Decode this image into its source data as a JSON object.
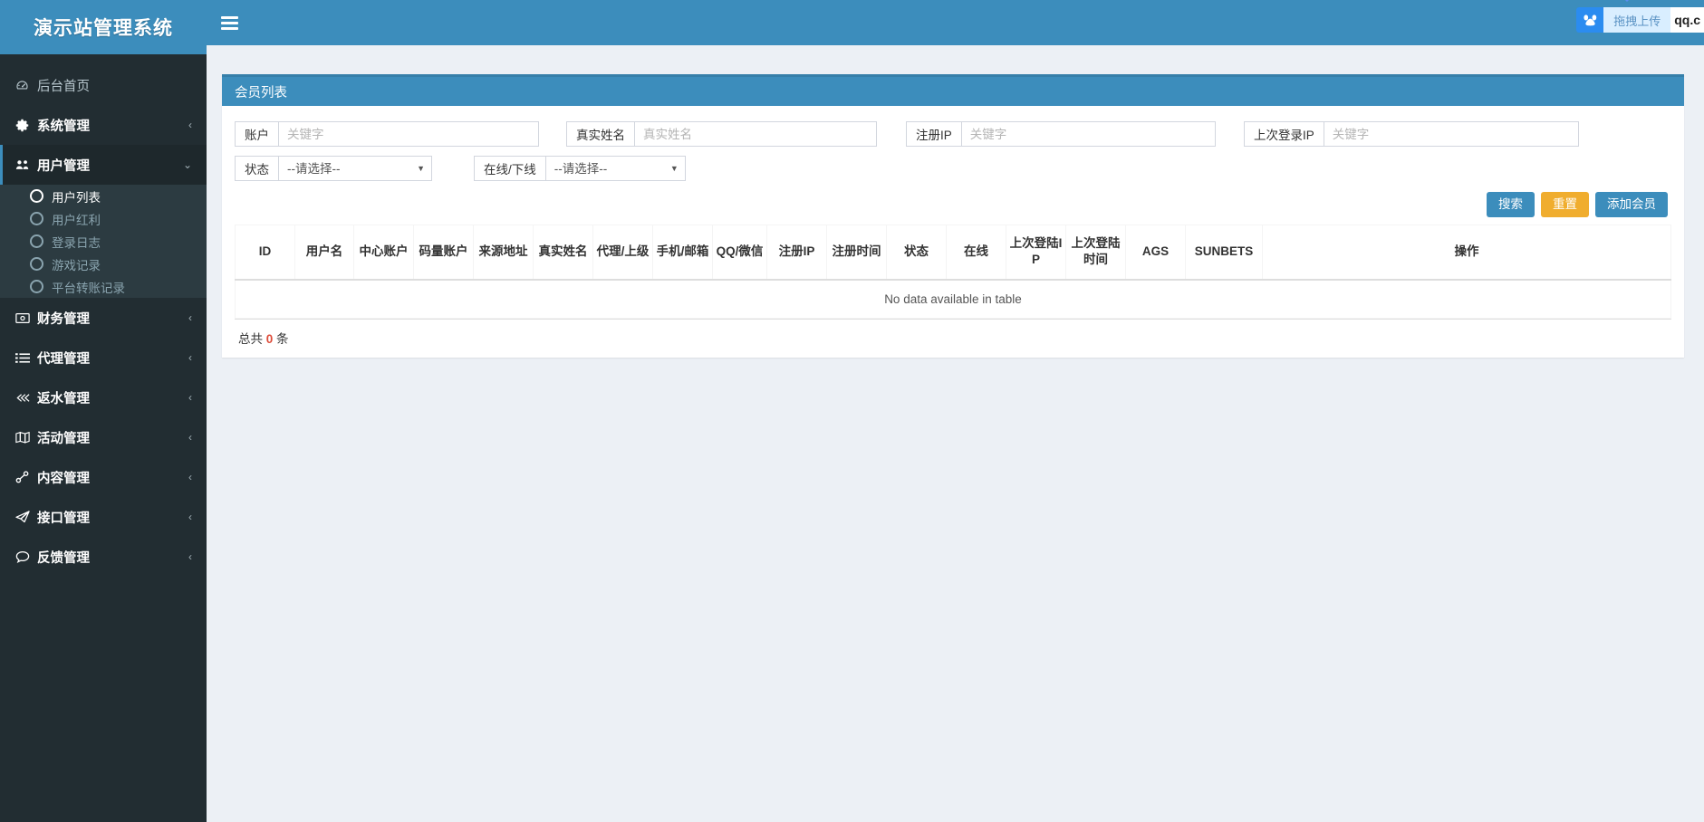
{
  "brand": {
    "title": "演示站管理系统"
  },
  "topbar": {
    "menu_toggle_icon": "hamburger-icon"
  },
  "netdisk": {
    "icon": "baidu-netdisk-icon",
    "button_label": "拖拽上传",
    "url_text": "qq.c"
  },
  "sidebar": {
    "items": [
      {
        "label": "后台首页",
        "icon": "dashboard-icon",
        "caret": "",
        "strong": false
      },
      {
        "label": "系统管理",
        "icon": "gear-icon",
        "caret": "‹",
        "strong": true
      },
      {
        "label": "用户管理",
        "icon": "users-icon",
        "caret": "⌄",
        "strong": true
      },
      {
        "label": "财务管理",
        "icon": "money-icon",
        "caret": "‹",
        "strong": true
      },
      {
        "label": "代理管理",
        "icon": "list-icon",
        "caret": "‹",
        "strong": true
      },
      {
        "label": "返水管理",
        "icon": "link-icon",
        "caret": "‹",
        "strong": true
      },
      {
        "label": "活动管理",
        "icon": "map-icon",
        "caret": "‹",
        "strong": true
      },
      {
        "label": "内容管理",
        "icon": "paperclip-icon",
        "caret": "‹",
        "strong": true
      },
      {
        "label": "接口管理",
        "icon": "paper-plane-icon",
        "caret": "‹",
        "strong": true
      },
      {
        "label": "反馈管理",
        "icon": "comment-icon",
        "caret": "‹",
        "strong": true
      }
    ],
    "submenu": [
      {
        "label": "用户列表",
        "active": true
      },
      {
        "label": "用户红利",
        "active": false
      },
      {
        "label": "登录日志",
        "active": false
      },
      {
        "label": "游戏记录",
        "active": false
      },
      {
        "label": "平台转账记录",
        "active": false
      }
    ]
  },
  "panel": {
    "title": "会员列表"
  },
  "search": {
    "fields": [
      {
        "name": "account",
        "label": "账户",
        "placeholder": "关键字",
        "value": "",
        "type": "text"
      },
      {
        "name": "realname",
        "label": "真实姓名",
        "placeholder": "真实姓名",
        "value": "",
        "type": "text"
      },
      {
        "name": "register-ip",
        "label": "注册IP",
        "placeholder": "关键字",
        "value": "",
        "type": "text"
      },
      {
        "name": "last-login-ip",
        "label": "上次登录IP",
        "placeholder": "关键字",
        "value": "",
        "type": "text"
      }
    ],
    "selects": [
      {
        "name": "status",
        "label": "状态",
        "value": "--请选择--",
        "options": [
          "--请选择--"
        ]
      },
      {
        "name": "online",
        "label": "在线/下线",
        "value": "--请选择--",
        "options": [
          "--请选择--"
        ]
      }
    ]
  },
  "buttons": {
    "search": "搜索",
    "reset": "重置",
    "add_member": "添加会员"
  },
  "table": {
    "columns": [
      "ID",
      "用户名",
      "中心账户",
      "码量账户",
      "来源地址",
      "真实姓名",
      "代理/上级",
      "手机/邮箱",
      "QQ/微信",
      "注册IP",
      "注册时间",
      "状态",
      "在线",
      "上次登陆IP",
      "上次登陆时间",
      "AGS",
      "SUNBETS",
      "操作"
    ],
    "rows": [],
    "empty_text": "No data available in table",
    "footer_prefix": "总共 ",
    "footer_count": "0",
    "footer_suffix": " 条"
  },
  "colors": {
    "brand_blue": "#3c8dbc",
    "sidebar_dark": "#222d32",
    "submenu_dark": "#2c3b41",
    "warning_orange": "#f0ad2e",
    "content_bg": "#ecf0f5",
    "count_red": "#dd4b39"
  }
}
